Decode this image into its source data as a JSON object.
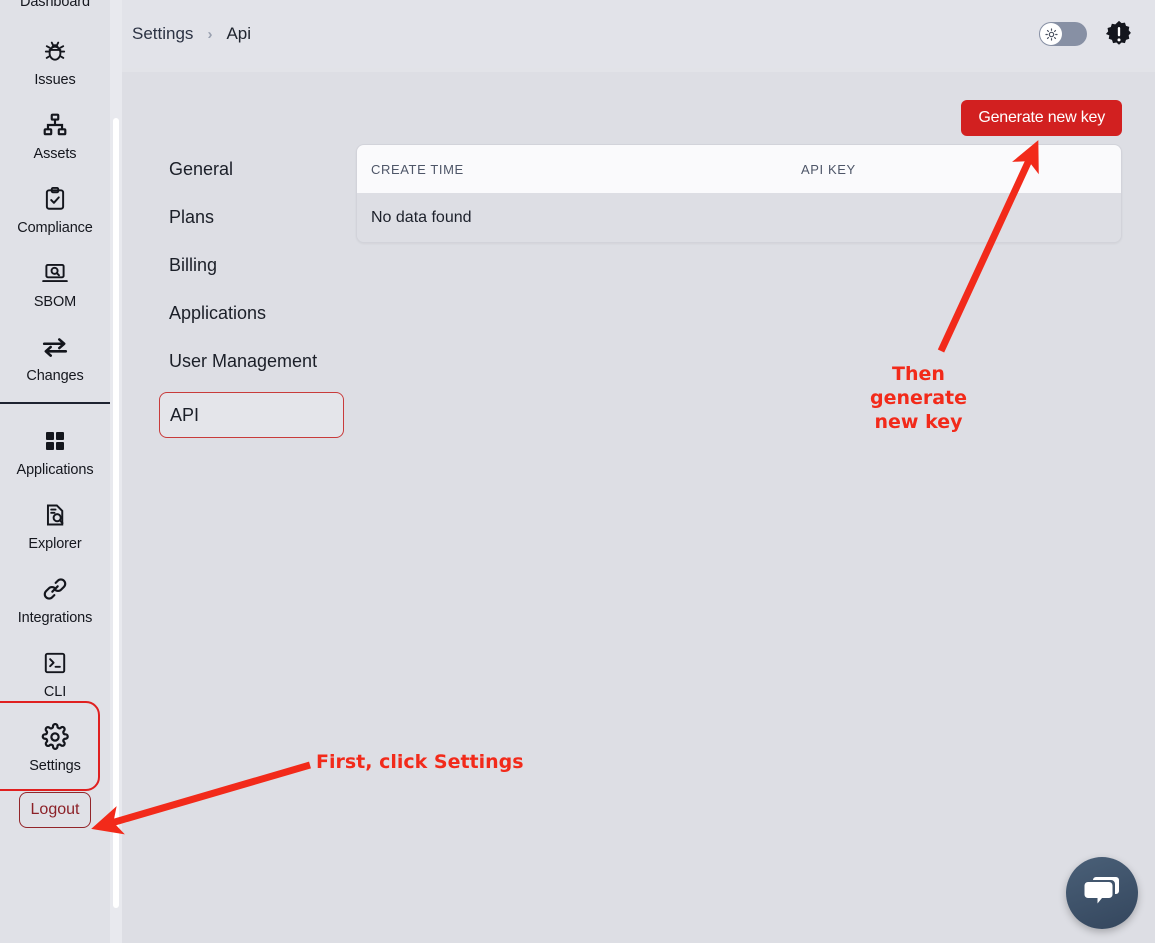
{
  "sidebar": {
    "items": [
      {
        "label": "Dashboard",
        "icon": "dashboard-icon",
        "cut_off": true
      },
      {
        "label": "Issues",
        "icon": "bug-icon",
        "cut_off": false
      },
      {
        "label": "Assets",
        "icon": "sitemap-icon",
        "cut_off": false
      },
      {
        "label": "Compliance",
        "icon": "clipboard-check-icon",
        "cut_off": false
      },
      {
        "label": "SBOM",
        "icon": "laptop-search-icon",
        "cut_off": false
      },
      {
        "label": "Changes",
        "icon": "arrows-exchange-icon",
        "cut_off": false
      }
    ],
    "items_lower": [
      {
        "label": "Applications",
        "icon": "grid-squares-icon"
      },
      {
        "label": "Explorer",
        "icon": "document-search-icon"
      },
      {
        "label": "Integrations",
        "icon": "link-chain-icon"
      },
      {
        "label": "CLI",
        "icon": "terminal-icon"
      },
      {
        "label": "Settings",
        "icon": "gear-icon",
        "highlighted": true
      }
    ],
    "logout_label": "Logout"
  },
  "header": {
    "breadcrumb": [
      {
        "label": "Settings"
      },
      {
        "label": "Api"
      }
    ],
    "separator": "›",
    "theme_toggle": {
      "state": "light",
      "icon": "sun-icon"
    },
    "alert_icon": "alert-badge-icon"
  },
  "main": {
    "generate_key_label": "Generate new key",
    "tabs": [
      {
        "label": "General",
        "active": false
      },
      {
        "label": "Plans",
        "active": false
      },
      {
        "label": "Billing",
        "active": false
      },
      {
        "label": "Applications",
        "active": false
      },
      {
        "label": "User Management",
        "active": false
      },
      {
        "label": "API",
        "active": true
      }
    ],
    "table": {
      "columns": [
        "CREATE TIME",
        "API KEY"
      ],
      "rows": [],
      "empty_message": "No data found"
    }
  },
  "annotations": {
    "step_one": "First, click Settings",
    "step_two_line1": "Then generate",
    "step_two_line2": "new key",
    "color": "#f22a1a"
  },
  "chat_widget": {
    "icon": "chat-bubbles-icon",
    "color": "#3f5570"
  },
  "colors": {
    "accent_red": "#d22020",
    "annotation_red": "#f22a1a",
    "sidebar_bg": "#e0e1e7",
    "content_bg": "#dddee4",
    "header_bg": "#e2e3e9"
  }
}
